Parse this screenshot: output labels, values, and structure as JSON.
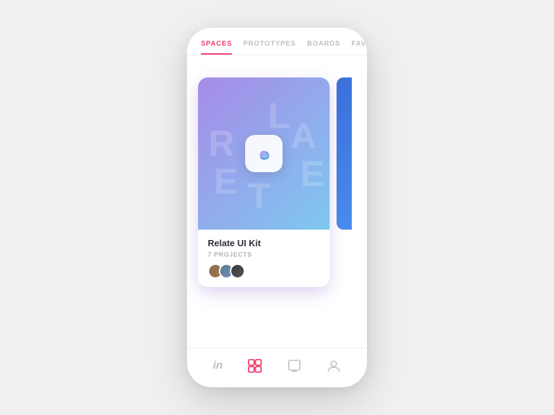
{
  "nav": {
    "tabs": [
      {
        "id": "spaces",
        "label": "SPACES",
        "active": true
      },
      {
        "id": "prototypes",
        "label": "PROTOTYPES",
        "active": false
      },
      {
        "id": "boards",
        "label": "BOARDS",
        "active": false
      },
      {
        "id": "favorites",
        "label": "FAVORITES",
        "active": false
      }
    ],
    "search_icon": "search"
  },
  "card": {
    "title": "Relate UI Kit",
    "subtitle": "7 PROJECTS",
    "letters": [
      "L",
      "A",
      "R",
      "E",
      "T",
      "E"
    ],
    "avatars": [
      "avatar-1",
      "avatar-2",
      "avatar-3"
    ]
  },
  "bottom_nav": {
    "items": [
      {
        "id": "invision",
        "icon": "in",
        "active": false
      },
      {
        "id": "boards",
        "icon": "□",
        "active": true
      },
      {
        "id": "prototypes",
        "icon": "▭",
        "active": false
      },
      {
        "id": "profile",
        "icon": "person",
        "active": false
      }
    ]
  }
}
